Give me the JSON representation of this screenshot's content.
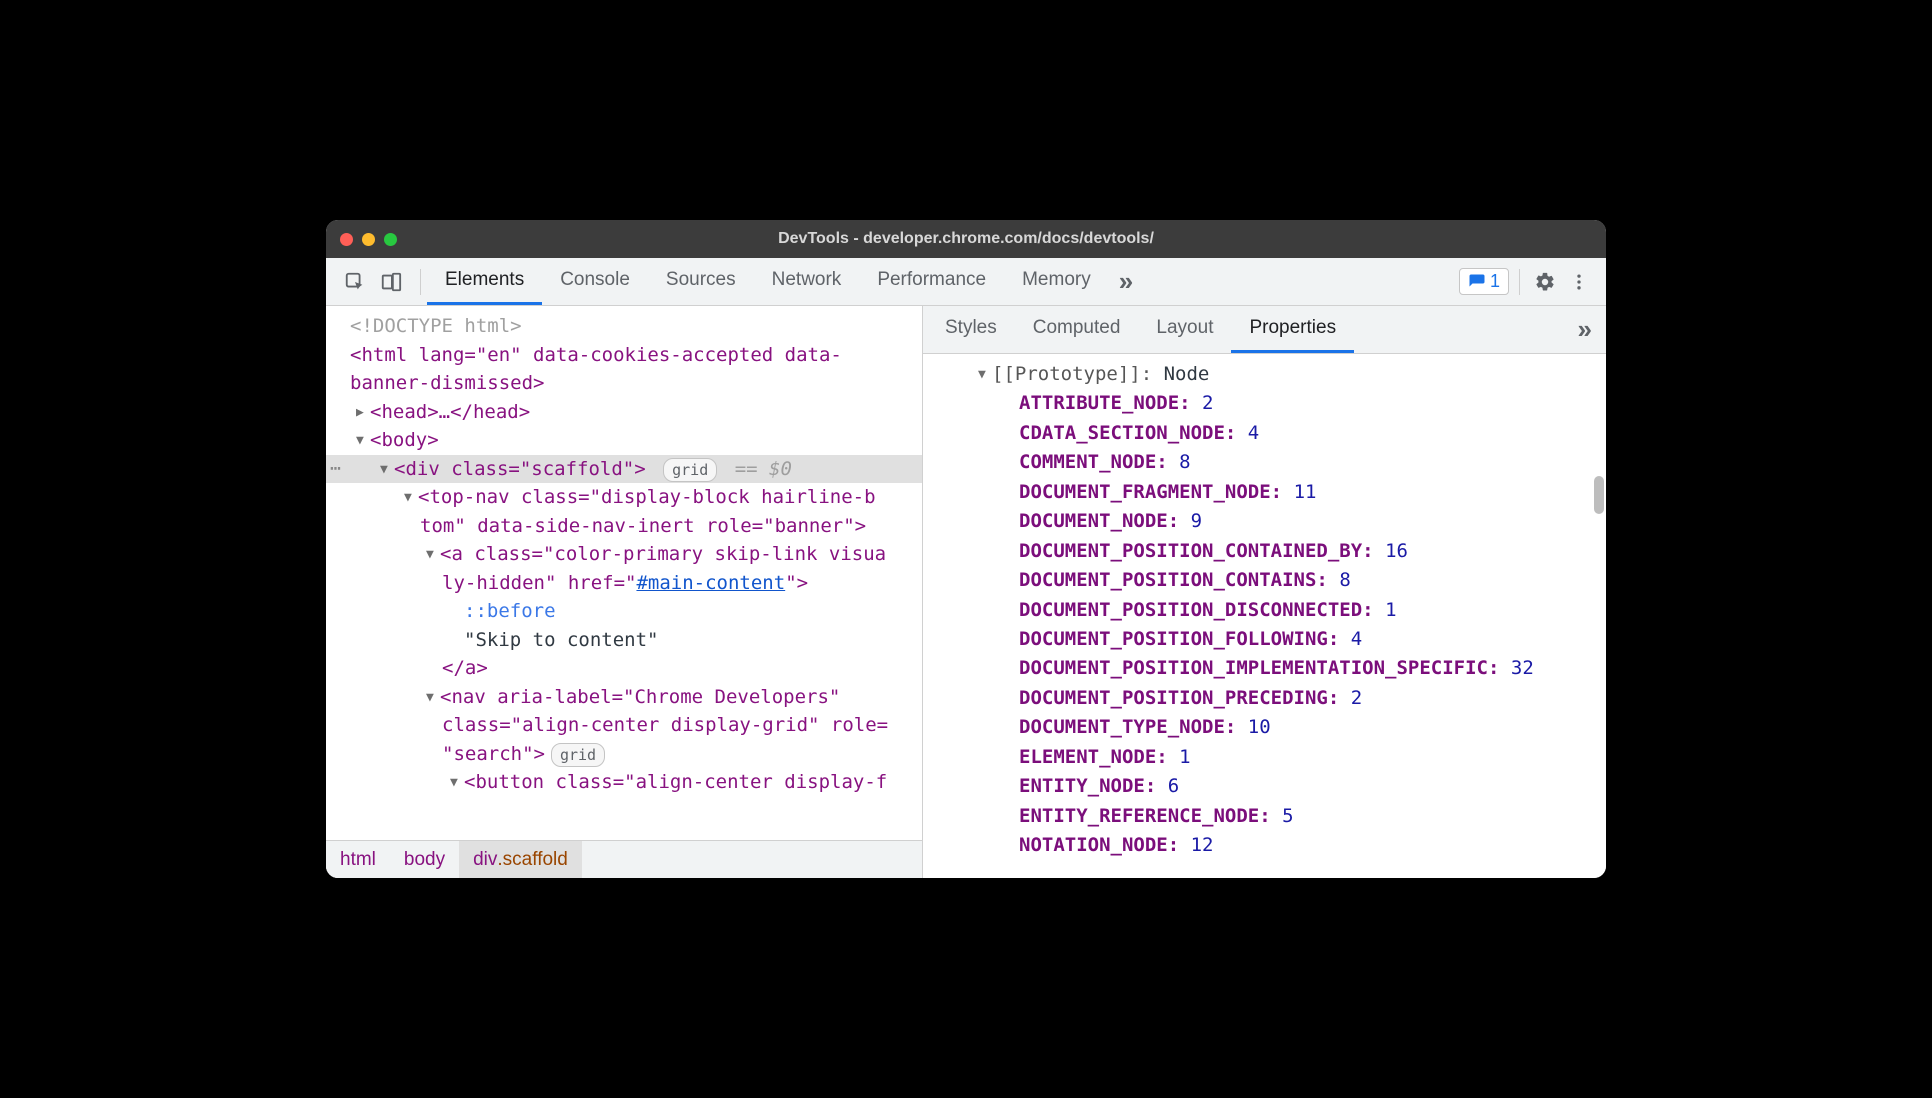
{
  "window": {
    "title": "DevTools - developer.chrome.com/docs/devtools/"
  },
  "toolbar": {
    "tabs": [
      "Elements",
      "Console",
      "Sources",
      "Network",
      "Performance",
      "Memory"
    ],
    "active_tab": "Elements",
    "issues_count": "1"
  },
  "side_tabs": {
    "items": [
      "Styles",
      "Computed",
      "Layout",
      "Properties"
    ],
    "active": "Properties"
  },
  "breadcrumb": [
    {
      "text": "html"
    },
    {
      "text": "body"
    },
    {
      "text": "div",
      "cls": ".scaffold",
      "active": true
    }
  ],
  "dom": {
    "doctype": "<!DOCTYPE html>",
    "html_open_1": "<html lang=\"en\" data-cookies-accepted data-",
    "html_open_2": "banner-dismissed>",
    "head": "<head>…</head>",
    "body": "<body>",
    "div_scaffold": "<div class=\"scaffold\">",
    "div_badge": "grid",
    "div_eq": "== $0",
    "topnav_1": "<top-nav class=\"display-block hairline-b",
    "topnav_2": "tom\" data-side-nav-inert role=\"banner\">",
    "a_1": "<a class=\"color-primary skip-link visua",
    "a_2_pre": "ly-hidden\" href=\"",
    "a_2_href": "#main-content",
    "a_2_post": "\">",
    "pseudo": "::before",
    "skip_text": "\"Skip to content\"",
    "a_close": "</a>",
    "nav_1": "<nav aria-label=\"Chrome Developers\"",
    "nav_2": "class=\"align-center display-grid\" role=",
    "nav_3": "\"search\">",
    "nav_badge": "grid",
    "button_1": "<button class=\"align-center display-f"
  },
  "properties": {
    "prototype_label": "[[Prototype]]",
    "prototype_value": "Node",
    "items": [
      {
        "k": "ATTRIBUTE_NODE",
        "v": "2"
      },
      {
        "k": "CDATA_SECTION_NODE",
        "v": "4"
      },
      {
        "k": "COMMENT_NODE",
        "v": "8"
      },
      {
        "k": "DOCUMENT_FRAGMENT_NODE",
        "v": "11"
      },
      {
        "k": "DOCUMENT_NODE",
        "v": "9"
      },
      {
        "k": "DOCUMENT_POSITION_CONTAINED_BY",
        "v": "16"
      },
      {
        "k": "DOCUMENT_POSITION_CONTAINS",
        "v": "8"
      },
      {
        "k": "DOCUMENT_POSITION_DISCONNECTED",
        "v": "1"
      },
      {
        "k": "DOCUMENT_POSITION_FOLLOWING",
        "v": "4"
      },
      {
        "k": "DOCUMENT_POSITION_IMPLEMENTATION_SPECIFIC",
        "v": "32"
      },
      {
        "k": "DOCUMENT_POSITION_PRECEDING",
        "v": "2"
      },
      {
        "k": "DOCUMENT_TYPE_NODE",
        "v": "10"
      },
      {
        "k": "ELEMENT_NODE",
        "v": "1"
      },
      {
        "k": "ENTITY_NODE",
        "v": "6"
      },
      {
        "k": "ENTITY_REFERENCE_NODE",
        "v": "5"
      },
      {
        "k": "NOTATION_NODE",
        "v": "12"
      }
    ]
  }
}
